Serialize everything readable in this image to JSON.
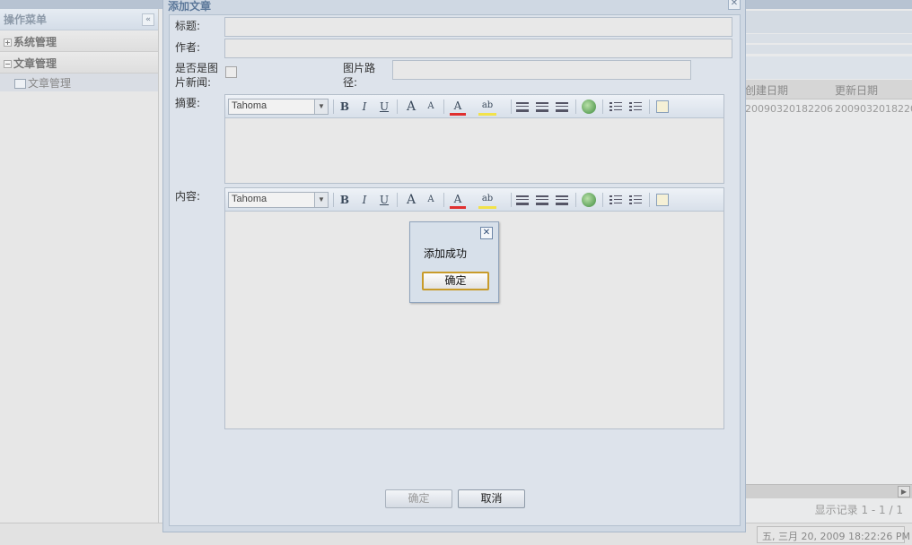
{
  "sidebar": {
    "title": "操作菜单",
    "groups": [
      {
        "label": "系统管理",
        "expanded": false
      },
      {
        "label": "文章管理",
        "expanded": true
      }
    ],
    "leaf": "文章管理"
  },
  "grid": {
    "columns": [
      "创建日期",
      "更新日期"
    ],
    "rows": [
      [
        "20090320182206",
        "20090320182206"
      ]
    ],
    "pager_info": "显示记录 1 - 1 / 1"
  },
  "statusbar": {
    "clock": "五, 三月 20, 2009 18:22:26 PM"
  },
  "dialog": {
    "title": "添加文章",
    "fields": {
      "title_label": "标题:",
      "title_value": "",
      "author_label": "作者:",
      "author_value": "",
      "picnews_label_line1": "是否是图",
      "picnews_label_line2": "片新闻:",
      "picnews_checked": false,
      "picpath_label_line1": "图片路",
      "picpath_label_line2": "径:",
      "picpath_value": "",
      "summary_label": "摘要:",
      "content_label": "内容:"
    },
    "editor_toolbar": {
      "font": "Tahoma",
      "bold": "B",
      "italic": "I",
      "underline": "U",
      "grow_font": "A",
      "shrink_font": "A",
      "font_color": "A",
      "highlight": "ab"
    },
    "buttons": {
      "ok": "确定",
      "cancel": "取消"
    }
  },
  "alert": {
    "message": "添加成功",
    "ok": "确定"
  },
  "colors": {
    "window_bg": "#cfd8e3",
    "title": "#5b7799",
    "alert_button_border": "#c89b2a"
  }
}
